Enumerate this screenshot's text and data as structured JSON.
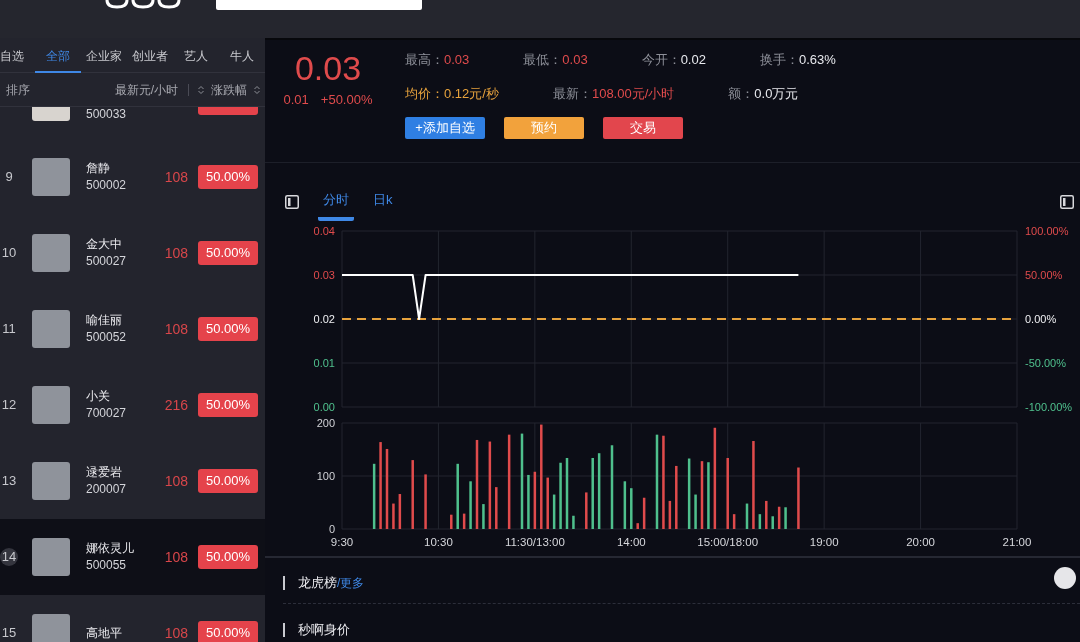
{
  "sidebar": {
    "tabs": [
      {
        "label": "自选",
        "selected": false
      },
      {
        "label": "全部",
        "selected": true
      },
      {
        "label": "企业家",
        "selected": false
      },
      {
        "label": "创业者",
        "selected": false
      },
      {
        "label": "艺人",
        "selected": false
      },
      {
        "label": "牛人",
        "selected": false
      }
    ],
    "columns": [
      {
        "label": "排序",
        "sortable": false
      },
      {
        "label": "最新元/小时",
        "sortable": true
      },
      {
        "label": "涨跌幅",
        "sortable": true
      }
    ],
    "rows": [
      {
        "kind": "partial",
        "code": "500033",
        "selected": false
      },
      {
        "kind": "full",
        "rank": "9",
        "name": "詹静",
        "code": "500002",
        "price": "108",
        "change": "50.00%",
        "selected": false
      },
      {
        "kind": "full",
        "rank": "10",
        "name": "金大中",
        "code": "500027",
        "price": "108",
        "change": "50.00%",
        "selected": false
      },
      {
        "kind": "full",
        "rank": "11",
        "name": "喻佳丽",
        "code": "500052",
        "price": "108",
        "change": "50.00%",
        "selected": false
      },
      {
        "kind": "full",
        "rank": "12",
        "name": "小关",
        "code": "700027",
        "price": "216",
        "change": "50.00%",
        "selected": false
      },
      {
        "kind": "full",
        "rank": "13",
        "name": "逯爱岩",
        "code": "200007",
        "price": "108",
        "change": "50.00%",
        "selected": false
      },
      {
        "kind": "full",
        "rank": "14",
        "name": "娜依灵儿",
        "code": "500055",
        "price": "108",
        "change": "50.00%",
        "selected": true
      },
      {
        "kind": "full",
        "rank": "15",
        "name": "高地平",
        "price": "108",
        "change": "50.00%",
        "selected": false
      }
    ]
  },
  "quote": {
    "price": "0.03",
    "change": "0.01",
    "change_percent": "+50.00%",
    "stat_rows": [
      [
        {
          "label": "最高：",
          "value": "0.03",
          "kind": "up"
        },
        {
          "label": "最低：",
          "value": "0.03",
          "kind": "up"
        },
        {
          "label": "今开：",
          "value": "0.02",
          "kind": "flat"
        },
        {
          "label": "换手：",
          "value": "0.63%",
          "kind": "flat"
        }
      ],
      [
        {
          "label": "均价：",
          "value": "0.12元/秒",
          "kind": "avg"
        },
        {
          "label": "最新：",
          "value": "108.00元/小时",
          "kind": "up"
        },
        {
          "label": "额：",
          "value": "0.0万元",
          "kind": "flat"
        }
      ]
    ],
    "buttons": [
      {
        "label": "+添加自选",
        "kind": "watch"
      },
      {
        "label": "预约",
        "kind": "reserve"
      },
      {
        "label": "交易",
        "kind": "trade"
      }
    ]
  },
  "chart": {
    "tabs": [
      {
        "label": "分时",
        "selected": true
      },
      {
        "label": "日k",
        "selected": false
      }
    ],
    "price_chart": {
      "chart_data": {
        "type": "line",
        "grid": true,
        "categories": [
          null,
          null,
          null,
          null,
          null,
          null,
          null,
          null,
          null,
          null,
          null,
          null,
          null,
          null,
          null,
          null,
          null,
          null,
          null,
          null,
          null,
          null,
          null,
          null,
          null,
          null,
          null,
          null,
          null,
          null,
          null,
          null,
          null,
          null,
          null,
          null,
          null,
          null,
          null,
          null,
          null,
          null,
          null,
          null,
          null,
          null,
          null,
          null,
          null,
          null,
          null,
          null,
          null,
          null,
          null,
          null,
          null,
          null,
          null,
          null,
          null,
          null,
          null,
          null,
          null,
          null,
          null,
          null,
          null,
          null,
          null,
          null,
          null,
          null,
          null,
          null,
          null,
          null,
          null,
          null,
          null,
          null,
          null,
          null,
          null,
          null,
          null,
          null,
          null,
          null,
          null,
          null,
          null,
          null,
          null,
          null,
          null,
          null,
          null,
          null,
          null,
          null,
          null,
          null,
          null,
          null
        ],
        "series": [
          {
            "color": "#ffffff",
            "values": [
              0.03,
              0.03,
              0.03,
              0.03,
              0.03,
              0.03,
              0.03,
              0.03,
              0.03,
              0.03,
              0.03,
              0.03,
              0.02,
              0.03,
              0.03,
              0.03,
              0.03,
              0.03,
              0.03,
              0.03,
              0.03,
              0.03,
              0.03,
              0.03,
              0.03,
              0.03,
              0.03,
              0.03,
              0.03,
              0.03,
              0.03,
              0.03,
              0.03,
              0.03,
              0.03,
              0.03,
              0.03,
              0.03,
              0.03,
              0.03,
              0.03,
              0.03,
              0.03,
              0.03,
              0.03,
              0.03,
              0.03,
              0.03,
              0.03,
              0.03,
              0.03,
              0.03,
              0.03,
              0.03,
              0.03,
              0.03,
              0.03,
              0.03,
              0.03,
              0.03,
              0.03,
              0.03,
              0.03,
              0.03,
              0.03,
              0.03,
              0.03,
              0.03,
              0.03,
              0.03,
              0.03,
              0.03,
              null,
              null,
              null,
              null,
              null,
              null,
              null,
              null,
              null,
              null,
              null,
              null,
              null,
              null,
              null,
              null,
              null,
              null,
              null,
              null,
              null,
              null,
              null,
              null,
              null,
              null,
              null,
              null,
              null,
              null,
              null,
              null,
              null,
              null
            ]
          }
        ],
        "ylim": [
          0,
          0.04
        ],
        "yticks": [
          {
            "value": 0,
            "label": "0.00"
          },
          {
            "value": 0.01,
            "label": "0.01"
          },
          {
            "value": 0.02,
            "label": "0.02"
          },
          {
            "value": 0.03,
            "label": "0.03"
          },
          {
            "value": 0.04,
            "label": "0.04"
          }
        ],
        "y2lim": [
          -100,
          100
        ],
        "y2ticks": [
          {
            "value": -100,
            "label": "-100.00%"
          },
          {
            "value": -50,
            "label": "-50.00%"
          },
          {
            "value": 0,
            "label": "0.00%"
          },
          {
            "value": 50,
            "label": "50.00%"
          },
          {
            "value": 100,
            "label": "100.00%"
          }
        ],
        "ref_lines": [
          {
            "axis": "y",
            "value": 0.02
          }
        ]
      }
    },
    "volume_chart": {
      "chart_data": {
        "type": "bar",
        "grid": true,
        "categories": [
          "9:30",
          null,
          null,
          null,
          null,
          null,
          null,
          null,
          null,
          null,
          null,
          null,
          null,
          null,
          null,
          "10:30",
          null,
          null,
          null,
          null,
          null,
          null,
          null,
          null,
          null,
          null,
          null,
          null,
          null,
          null,
          "11:30/13:00",
          null,
          null,
          null,
          null,
          null,
          null,
          null,
          null,
          null,
          null,
          null,
          null,
          null,
          null,
          "14:00",
          null,
          null,
          null,
          null,
          null,
          null,
          null,
          null,
          null,
          null,
          null,
          null,
          null,
          null,
          "15:00/18:00",
          null,
          null,
          null,
          null,
          null,
          null,
          null,
          null,
          null,
          null,
          null,
          null,
          null,
          null,
          "19:00",
          null,
          null,
          null,
          null,
          null,
          null,
          null,
          null,
          null,
          null,
          null,
          null,
          null,
          null,
          "20:00",
          null,
          null,
          null,
          null,
          null,
          null,
          null,
          null,
          null,
          null,
          null,
          null,
          null,
          null,
          "21:00"
        ],
        "series": [
          {
            "color": "#e04b4c",
            "values": [
              null,
              null,
              null,
              null,
              null,
              null,
              164,
              151,
              48,
              66,
              null,
              130,
              null,
              103,
              null,
              null,
              null,
              27,
              null,
              29,
              null,
              168,
              null,
              165,
              79,
              null,
              178,
              null,
              null,
              null,
              108,
              197,
              97,
              null,
              null,
              null,
              null,
              null,
              69,
              null,
              null,
              null,
              null,
              null,
              null,
              null,
              11,
              59,
              null,
              null,
              176,
              53,
              119,
              null,
              null,
              null,
              128,
              null,
              191,
              null,
              134,
              28,
              null,
              null,
              166,
              null,
              53,
              null,
              42,
              null,
              null,
              116,
              null,
              null,
              null,
              null,
              null,
              null,
              null,
              null,
              null,
              null,
              null,
              null,
              null,
              null,
              null,
              null,
              null,
              null,
              null,
              null,
              null,
              null,
              null,
              null,
              null,
              null,
              null,
              null,
              null,
              null,
              null,
              null,
              null,
              null
            ]
          },
          {
            "color": "#4fc08d",
            "values": [
              null,
              null,
              null,
              null,
              null,
              123,
              null,
              null,
              null,
              null,
              null,
              null,
              null,
              null,
              null,
              null,
              null,
              null,
              123,
              null,
              90,
              null,
              47,
              null,
              null,
              null,
              null,
              null,
              180,
              102,
              null,
              null,
              null,
              65,
              125,
              134,
              25,
              null,
              null,
              134,
              143,
              null,
              158,
              null,
              90,
              77,
              null,
              null,
              null,
              178,
              null,
              null,
              null,
              null,
              133,
              65,
              null,
              126,
              null,
              null,
              null,
              null,
              null,
              48,
              null,
              28,
              null,
              24,
              null,
              41,
              null,
              null,
              null,
              null,
              null,
              null,
              null,
              null,
              null,
              null,
              null,
              null,
              null,
              null,
              null,
              null,
              null,
              null,
              null,
              null,
              null,
              null,
              null,
              null,
              null,
              null,
              null,
              null,
              null,
              null,
              null,
              null,
              null,
              null,
              null,
              null
            ]
          }
        ],
        "ylim": [
          0,
          200
        ],
        "yticks": [
          0,
          100,
          200
        ]
      }
    }
  },
  "sections": [
    {
      "title": "龙虎榜",
      "link": "/更多"
    },
    {
      "title": "秒啊身价"
    }
  ]
}
